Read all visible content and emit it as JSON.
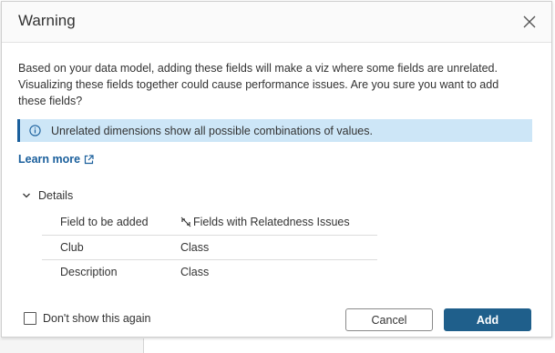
{
  "dialog": {
    "title": "Warning",
    "message": "Based on your data model, adding these fields will make a viz where some fields are unrelated. Visualizing these fields together could cause performance issues. Are you sure you want to add these fields?",
    "info_banner": "Unrelated dimensions show all possible combinations of values.",
    "learn_more": "Learn more",
    "details_label": "Details",
    "table": {
      "headers": [
        "Field to be added",
        "Fields with Relatedness Issues"
      ],
      "rows": [
        [
          "Club",
          "Class"
        ],
        [
          "Description",
          "Class"
        ]
      ]
    },
    "dont_show_label": "Don't show this again",
    "dont_show_checked": false,
    "cancel_label": "Cancel",
    "add_label": "Add"
  },
  "colors": {
    "accent": "#1f5f8b",
    "link": "#1a5f9c",
    "info_bg": "#cde6f7"
  },
  "icons": {
    "close": "close-icon",
    "info": "info-icon",
    "external_link": "external-link-icon",
    "chevron": "chevron-down-icon",
    "relatedness": "unlink-icon"
  }
}
